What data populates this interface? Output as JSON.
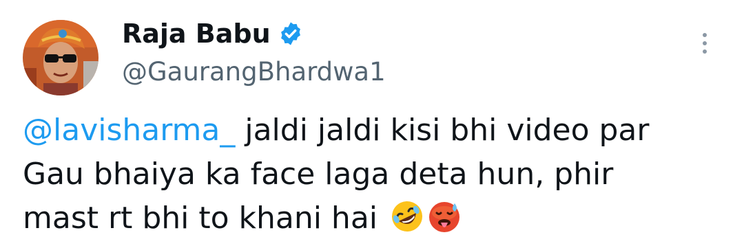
{
  "tweet": {
    "author": {
      "display_name": "Raja Babu",
      "handle": "@GaurangBhardwa1",
      "verified": true
    },
    "text": {
      "mention": "@lavisharma_",
      "line1_rest": " jaldi jaldi kisi bhi video par",
      "line2": "Gau bhaiya ka face laga deta hun, phir",
      "line3": "mast rt bhi to khani hai"
    },
    "emojis": [
      "rolling-on-floor-laughing",
      "hot-face"
    ],
    "colors": {
      "link": "#1d9bf0",
      "secondary_text": "#536471",
      "verified_badge": "#1d9bf0"
    }
  }
}
